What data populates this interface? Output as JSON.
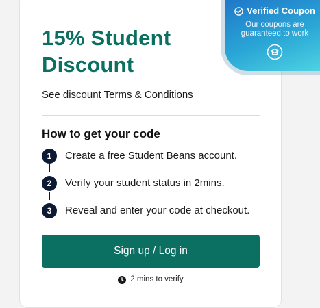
{
  "offer": {
    "title": "15% Student\nDiscount",
    "terms_link": "See discount Terms & Conditions"
  },
  "badge": {
    "title": "Verified Coupon",
    "subtitle_line1": "Our coupons are",
    "subtitle_line2": "guaranteed to work",
    "check_icon": "check-circle-icon",
    "emblem_icon": "mortarboard-icon"
  },
  "how": {
    "title": "How to get your code",
    "steps": [
      {
        "num": "1",
        "text": "Create a free Student Beans account."
      },
      {
        "num": "2",
        "text": "Verify your student status in 2mins."
      },
      {
        "num": "3",
        "text": "Reveal and enter your code at checkout."
      }
    ]
  },
  "cta": {
    "label": "Sign up / Log in"
  },
  "verify": {
    "text": "2 mins to verify",
    "icon": "clock-icon"
  },
  "colors": {
    "brand_green": "#0b6f61",
    "step_navy": "#0d1a33",
    "badge_blue": "#1e73c8",
    "badge_cyan": "#4fd6e3"
  }
}
